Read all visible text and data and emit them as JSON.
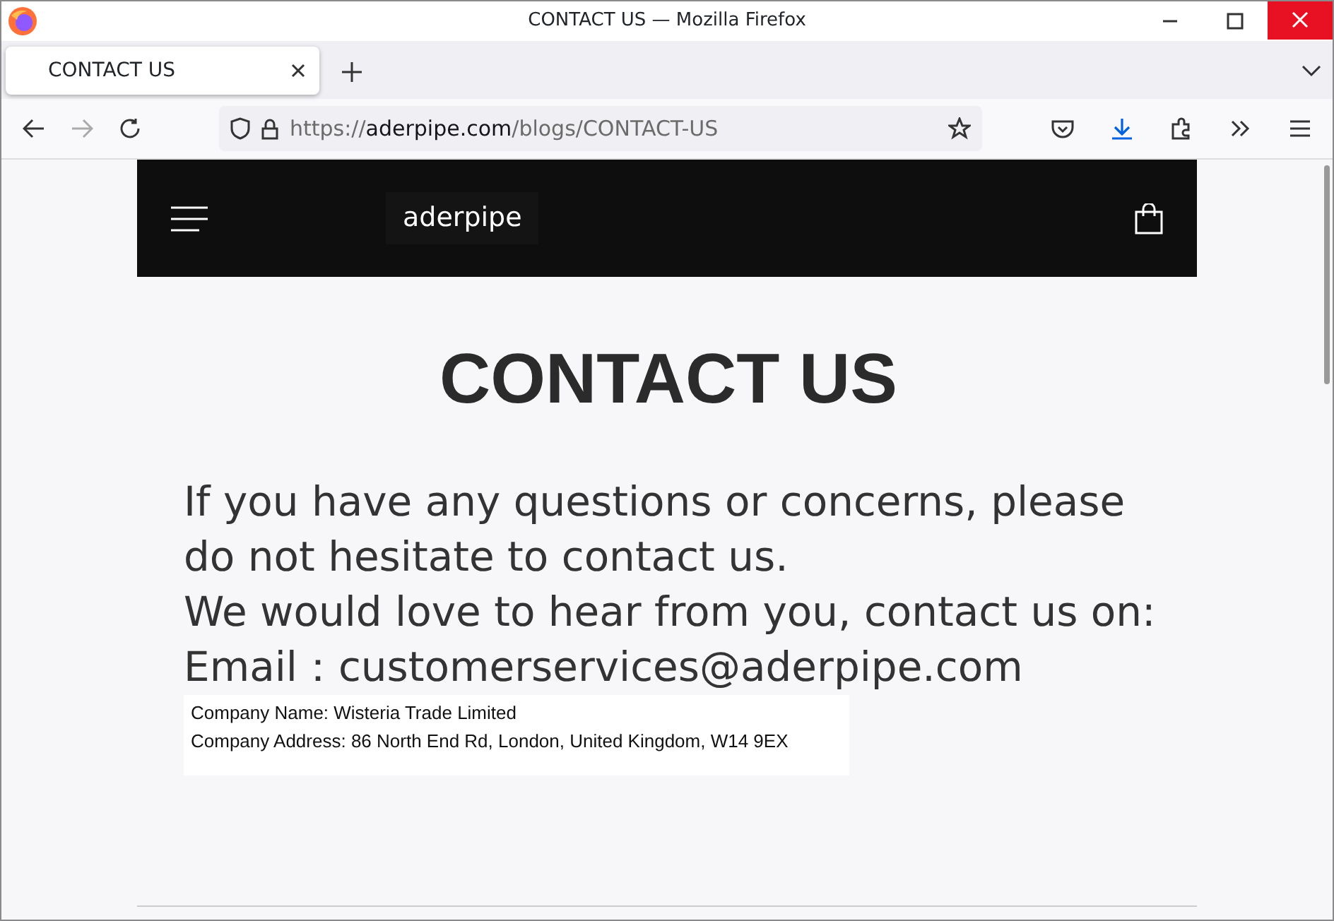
{
  "window": {
    "title": "CONTACT US — Mozilla Firefox"
  },
  "tabs": [
    {
      "label": "CONTACT US",
      "selected": true
    }
  ],
  "address_bar": {
    "scheme": "https://",
    "domain": "aderpipe.com",
    "path": "/blogs/CONTACT-US"
  },
  "site_header": {
    "logo": "aderpipe"
  },
  "page": {
    "heading": "CONTACT US",
    "paragraphs": [
      "If you have any questions or concerns, please do not hesitate to contact us.",
      "We would love to hear from you, contact us on:",
      "Email：customerservices@aderpipe.com"
    ],
    "company_info": [
      "Company Name: Wisteria Trade Limited",
      "Company Address: 86 North End Rd, London, United Kingdom, W14 9EX"
    ]
  }
}
